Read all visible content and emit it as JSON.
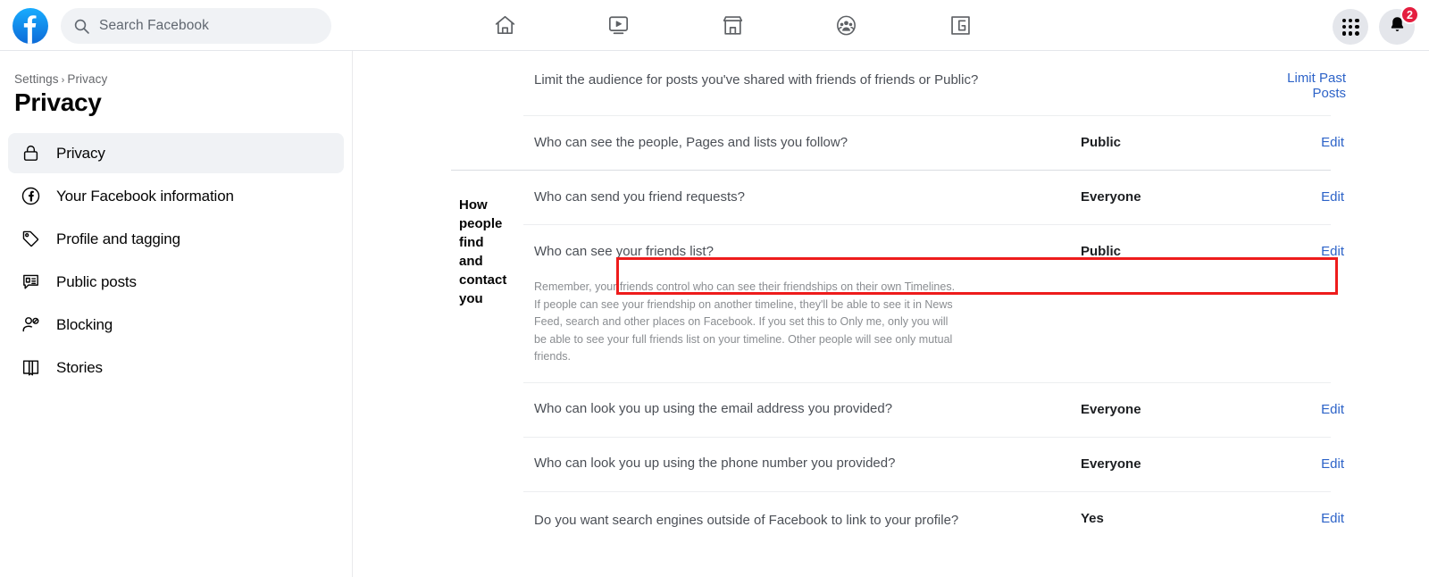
{
  "header": {
    "logo_alt": "facebook-logo",
    "search": {
      "placeholder": "Search Facebook",
      "value": ""
    },
    "nav_items": [
      {
        "name": "home",
        "label": "Home"
      },
      {
        "name": "watch",
        "label": "Watch"
      },
      {
        "name": "marketplace",
        "label": "Marketplace"
      },
      {
        "name": "groups",
        "label": "Groups"
      },
      {
        "name": "gaming",
        "label": "Gaming"
      }
    ],
    "menu_label": "Menu",
    "notifications_label": "Notifications",
    "notifications_count": "2"
  },
  "sidebar": {
    "breadcrumb": {
      "parent": "Settings",
      "separator": "›",
      "current": "Privacy"
    },
    "title": "Privacy",
    "items": [
      {
        "label": "Privacy",
        "icon": "lock-icon",
        "active": true
      },
      {
        "label": "Your Facebook information",
        "icon": "facebook-circle-icon",
        "active": false
      },
      {
        "label": "Profile and tagging",
        "icon": "tag-icon",
        "active": false
      },
      {
        "label": "Public posts",
        "icon": "comment-icon",
        "active": false
      },
      {
        "label": "Blocking",
        "icon": "block-user-icon",
        "active": false
      },
      {
        "label": "Stories",
        "icon": "book-icon",
        "active": false
      }
    ]
  },
  "main": {
    "top_rows": [
      {
        "question": "Limit the audience for posts you've shared with friends of friends or Public?",
        "value": "",
        "action": "Limit Past Posts"
      },
      {
        "question": "Who can see the people, Pages and lists you follow?",
        "value": "Public",
        "action": "Edit"
      }
    ],
    "section": {
      "label": "How people find and contact you",
      "rows": [
        {
          "question": "Who can send you friend requests?",
          "value": "Everyone",
          "action": "Edit",
          "note": "",
          "highlighted": false
        },
        {
          "question": "Who can see your friends list?",
          "value": "Public",
          "action": "Edit",
          "note": "Remember, your friends control who can see their friendships on their own Timelines. If people can see your friendship on another timeline, they'll be able to see it in News Feed, search and other places on Facebook. If you set this to Only me, only you will be able to see your full friends list on your timeline. Other people will see only mutual friends.",
          "highlighted": true
        },
        {
          "question": "Who can look you up using the email address you provided?",
          "value": "Everyone",
          "action": "Edit",
          "note": "",
          "highlighted": false
        },
        {
          "question": "Who can look you up using the phone number you provided?",
          "value": "Everyone",
          "action": "Edit",
          "note": "",
          "highlighted": false
        },
        {
          "question": "Do you want search engines outside of Facebook to link to your profile?",
          "value": "Yes",
          "action": "Edit",
          "note": "",
          "highlighted": false
        }
      ]
    }
  },
  "colors": {
    "brand_blue": "#1877F2",
    "link_blue": "#2d63c8",
    "highlight_red": "#ee1c1c",
    "badge_red": "#e41e3f"
  }
}
